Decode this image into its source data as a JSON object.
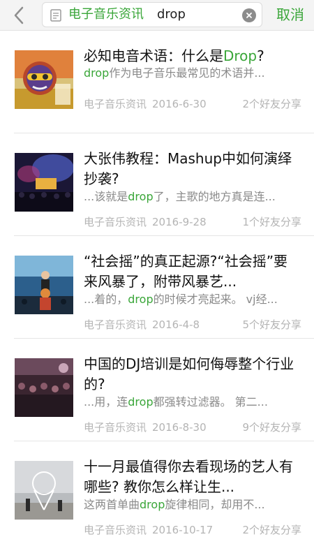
{
  "header": {
    "back_icon": "chevron-left-icon",
    "search_tag": "电子音乐资讯",
    "search_query": "drop",
    "clear_icon": "clear-icon",
    "cancel_label": "取消",
    "accent_color": "#3aa639"
  },
  "results": [
    {
      "title_pre": "必知电音术语：什么是",
      "title_hl": "Drop",
      "title_post": "?",
      "snippet_pre": "",
      "snippet_hl": "drop",
      "snippet_post": "作为电子音乐最常见的术语并...",
      "source": "电子音乐资讯",
      "date": "2016-6-30",
      "shares": "2个好友分享"
    },
    {
      "title_pre": "大张伟教程：Mashup中如何演绎抄袭?",
      "title_hl": "",
      "title_post": "",
      "snippet_pre": "...该就是",
      "snippet_hl": "drop",
      "snippet_post": "了，主歌的地方真是连...",
      "source": "电子音乐资讯",
      "date": "2016-9-28",
      "shares": "1个好友分享"
    },
    {
      "title_pre": "“社会摇”的真正起源?“社会摇”要来风暴了，附带风暴艺...",
      "title_hl": "",
      "title_post": "",
      "snippet_pre": "...着的，",
      "snippet_hl": "drop",
      "snippet_post": "的时候才亮起来。 vj经...",
      "source": "电子音乐资讯",
      "date": "2016-4-8",
      "shares": "5个好友分享"
    },
    {
      "title_pre": "中国的DJ培训是如何侮辱整个行业的?",
      "title_hl": "",
      "title_post": "",
      "snippet_pre": "...用，连",
      "snippet_hl": "drop",
      "snippet_post": "都强转过滤器。 第二...",
      "source": "电子音乐资讯",
      "date": "2016-8-30",
      "shares": "9个好友分享"
    },
    {
      "title_pre": "十一月最值得你去看现场的艺人有哪些? 教你怎么样让生...",
      "title_hl": "",
      "title_post": "",
      "snippet_pre": "这两首单曲",
      "snippet_hl": "drop",
      "snippet_post": "旋律相同，却用不...",
      "source": "电子音乐资讯",
      "date": "2016-10-17",
      "shares": "2个好友分享"
    }
  ]
}
